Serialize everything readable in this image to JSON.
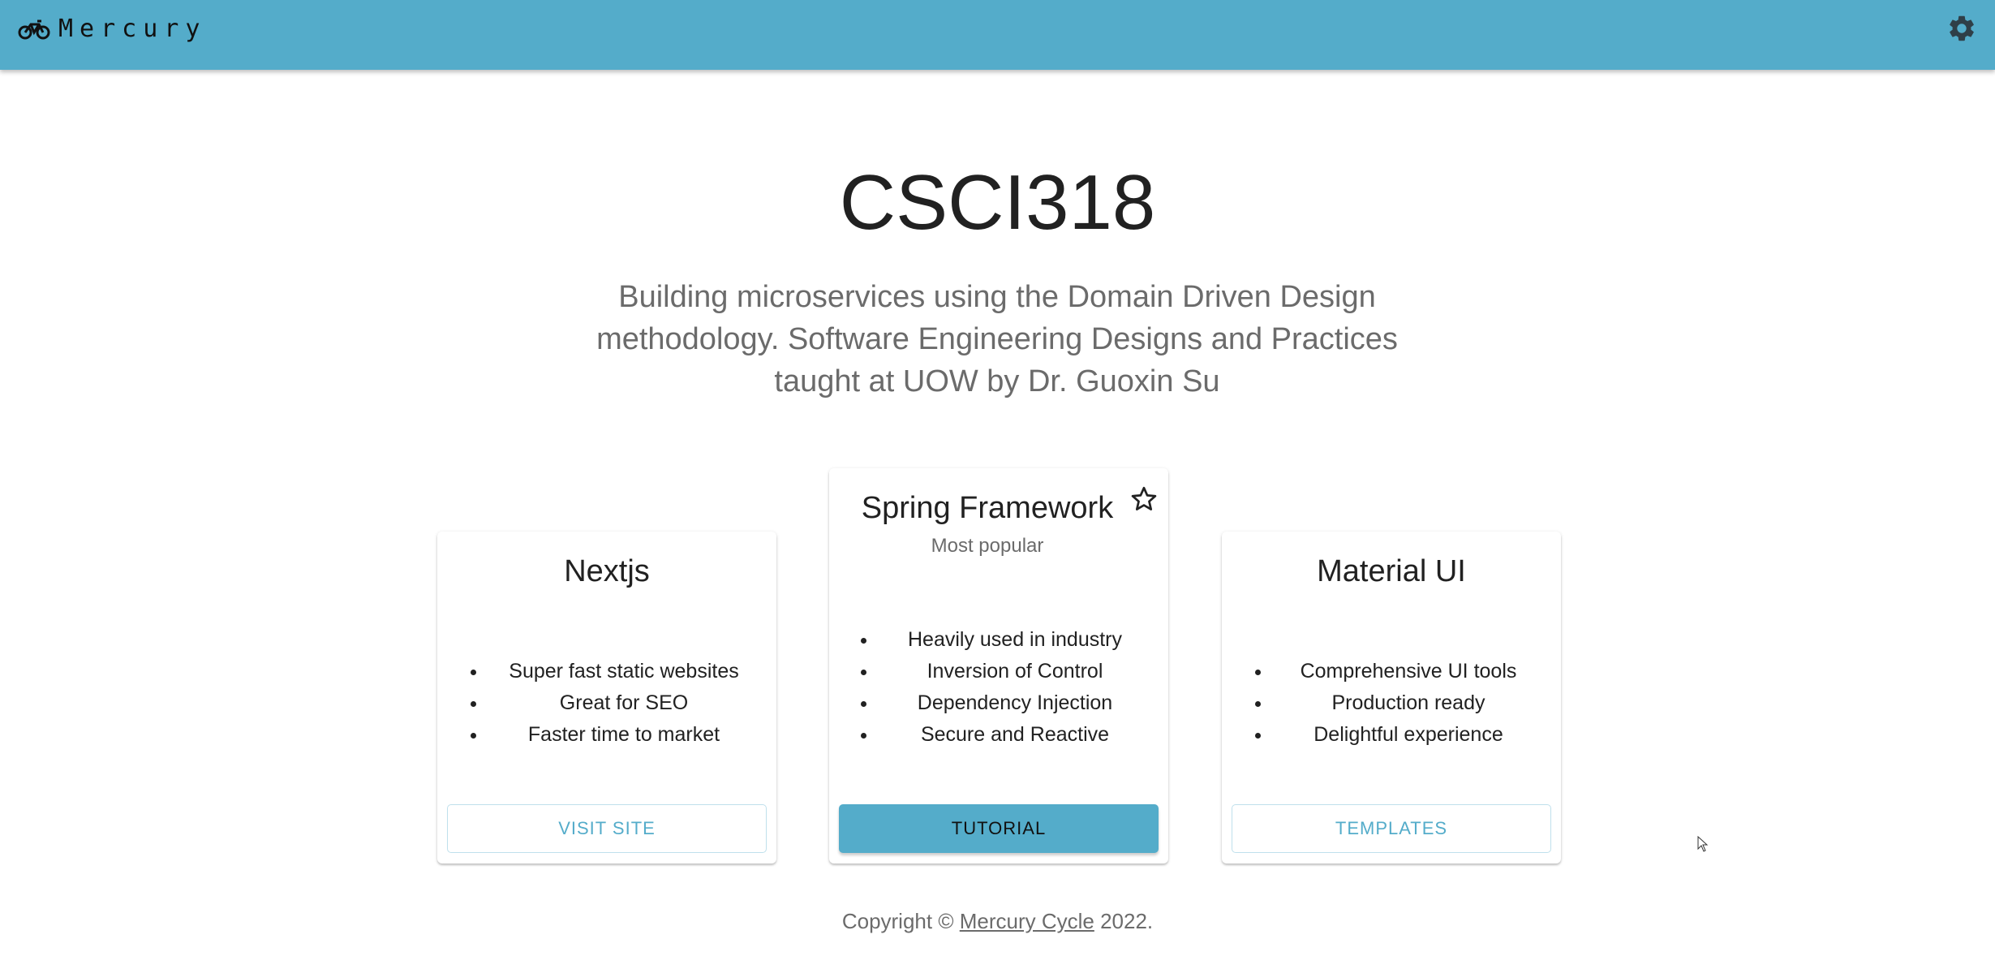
{
  "header": {
    "brand": "Mercury",
    "brand_icon": "bicycle-icon",
    "settings_icon": "gear-icon",
    "color": "#54acca"
  },
  "hero": {
    "title": "CSCI318",
    "subtitle": "Building microservices using the Domain Driven Design methodology. Software Engineering Designs and Practices taught at UOW by Dr. Guoxin Su"
  },
  "cards": [
    {
      "title": "Nextjs",
      "features": [
        "Super fast static websites",
        "Great for SEO",
        "Faster time to market"
      ],
      "button": "VISIT SITE"
    },
    {
      "title": "Spring Framework",
      "subtitle": "Most popular",
      "icon": "star-outline-icon",
      "features": [
        "Heavily used in industry",
        "Inversion of Control",
        "Dependency Injection",
        "Secure and Reactive"
      ],
      "button": "TUTORIAL"
    },
    {
      "title": "Material UI",
      "features": [
        "Comprehensive UI tools",
        "Production ready",
        "Delightful experience"
      ],
      "button": "TEMPLATES"
    }
  ],
  "footer": {
    "prefix": "Copyright © ",
    "link": "Mercury Cycle",
    "suffix": " 2022."
  }
}
